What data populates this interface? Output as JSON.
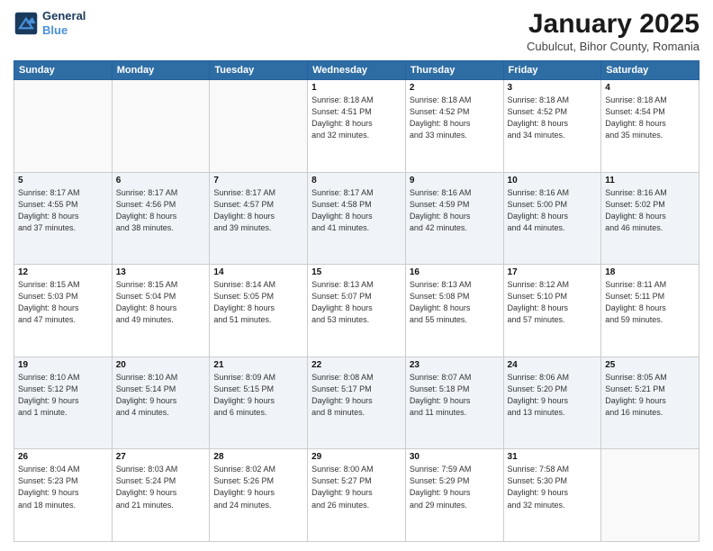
{
  "logo": {
    "line1": "General",
    "line2": "Blue"
  },
  "title": "January 2025",
  "subtitle": "Cubulcut, Bihor County, Romania",
  "days_of_week": [
    "Sunday",
    "Monday",
    "Tuesday",
    "Wednesday",
    "Thursday",
    "Friday",
    "Saturday"
  ],
  "weeks": [
    [
      {
        "day": "",
        "info": ""
      },
      {
        "day": "",
        "info": ""
      },
      {
        "day": "",
        "info": ""
      },
      {
        "day": "1",
        "info": "Sunrise: 8:18 AM\nSunset: 4:51 PM\nDaylight: 8 hours\nand 32 minutes."
      },
      {
        "day": "2",
        "info": "Sunrise: 8:18 AM\nSunset: 4:52 PM\nDaylight: 8 hours\nand 33 minutes."
      },
      {
        "day": "3",
        "info": "Sunrise: 8:18 AM\nSunset: 4:52 PM\nDaylight: 8 hours\nand 34 minutes."
      },
      {
        "day": "4",
        "info": "Sunrise: 8:18 AM\nSunset: 4:54 PM\nDaylight: 8 hours\nand 35 minutes."
      }
    ],
    [
      {
        "day": "5",
        "info": "Sunrise: 8:17 AM\nSunset: 4:55 PM\nDaylight: 8 hours\nand 37 minutes."
      },
      {
        "day": "6",
        "info": "Sunrise: 8:17 AM\nSunset: 4:56 PM\nDaylight: 8 hours\nand 38 minutes."
      },
      {
        "day": "7",
        "info": "Sunrise: 8:17 AM\nSunset: 4:57 PM\nDaylight: 8 hours\nand 39 minutes."
      },
      {
        "day": "8",
        "info": "Sunrise: 8:17 AM\nSunset: 4:58 PM\nDaylight: 8 hours\nand 41 minutes."
      },
      {
        "day": "9",
        "info": "Sunrise: 8:16 AM\nSunset: 4:59 PM\nDaylight: 8 hours\nand 42 minutes."
      },
      {
        "day": "10",
        "info": "Sunrise: 8:16 AM\nSunset: 5:00 PM\nDaylight: 8 hours\nand 44 minutes."
      },
      {
        "day": "11",
        "info": "Sunrise: 8:16 AM\nSunset: 5:02 PM\nDaylight: 8 hours\nand 46 minutes."
      }
    ],
    [
      {
        "day": "12",
        "info": "Sunrise: 8:15 AM\nSunset: 5:03 PM\nDaylight: 8 hours\nand 47 minutes."
      },
      {
        "day": "13",
        "info": "Sunrise: 8:15 AM\nSunset: 5:04 PM\nDaylight: 8 hours\nand 49 minutes."
      },
      {
        "day": "14",
        "info": "Sunrise: 8:14 AM\nSunset: 5:05 PM\nDaylight: 8 hours\nand 51 minutes."
      },
      {
        "day": "15",
        "info": "Sunrise: 8:13 AM\nSunset: 5:07 PM\nDaylight: 8 hours\nand 53 minutes."
      },
      {
        "day": "16",
        "info": "Sunrise: 8:13 AM\nSunset: 5:08 PM\nDaylight: 8 hours\nand 55 minutes."
      },
      {
        "day": "17",
        "info": "Sunrise: 8:12 AM\nSunset: 5:10 PM\nDaylight: 8 hours\nand 57 minutes."
      },
      {
        "day": "18",
        "info": "Sunrise: 8:11 AM\nSunset: 5:11 PM\nDaylight: 8 hours\nand 59 minutes."
      }
    ],
    [
      {
        "day": "19",
        "info": "Sunrise: 8:10 AM\nSunset: 5:12 PM\nDaylight: 9 hours\nand 1 minute."
      },
      {
        "day": "20",
        "info": "Sunrise: 8:10 AM\nSunset: 5:14 PM\nDaylight: 9 hours\nand 4 minutes."
      },
      {
        "day": "21",
        "info": "Sunrise: 8:09 AM\nSunset: 5:15 PM\nDaylight: 9 hours\nand 6 minutes."
      },
      {
        "day": "22",
        "info": "Sunrise: 8:08 AM\nSunset: 5:17 PM\nDaylight: 9 hours\nand 8 minutes."
      },
      {
        "day": "23",
        "info": "Sunrise: 8:07 AM\nSunset: 5:18 PM\nDaylight: 9 hours\nand 11 minutes."
      },
      {
        "day": "24",
        "info": "Sunrise: 8:06 AM\nSunset: 5:20 PM\nDaylight: 9 hours\nand 13 minutes."
      },
      {
        "day": "25",
        "info": "Sunrise: 8:05 AM\nSunset: 5:21 PM\nDaylight: 9 hours\nand 16 minutes."
      }
    ],
    [
      {
        "day": "26",
        "info": "Sunrise: 8:04 AM\nSunset: 5:23 PM\nDaylight: 9 hours\nand 18 minutes."
      },
      {
        "day": "27",
        "info": "Sunrise: 8:03 AM\nSunset: 5:24 PM\nDaylight: 9 hours\nand 21 minutes."
      },
      {
        "day": "28",
        "info": "Sunrise: 8:02 AM\nSunset: 5:26 PM\nDaylight: 9 hours\nand 24 minutes."
      },
      {
        "day": "29",
        "info": "Sunrise: 8:00 AM\nSunset: 5:27 PM\nDaylight: 9 hours\nand 26 minutes."
      },
      {
        "day": "30",
        "info": "Sunrise: 7:59 AM\nSunset: 5:29 PM\nDaylight: 9 hours\nand 29 minutes."
      },
      {
        "day": "31",
        "info": "Sunrise: 7:58 AM\nSunset: 5:30 PM\nDaylight: 9 hours\nand 32 minutes."
      },
      {
        "day": "",
        "info": ""
      }
    ]
  ]
}
